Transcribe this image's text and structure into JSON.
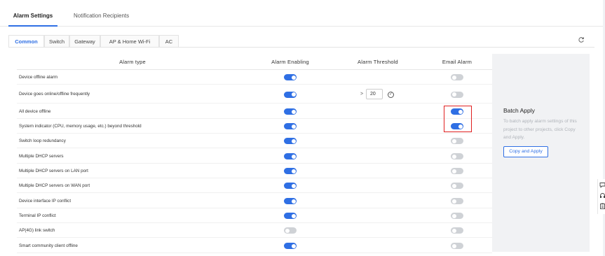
{
  "top_tabs": [
    {
      "label": "Alarm Settings",
      "active": true
    },
    {
      "label": "Notification Recipients",
      "active": false
    }
  ],
  "sub_tabs": [
    {
      "label": "Common",
      "active": true
    },
    {
      "label": "Switch",
      "active": false
    },
    {
      "label": "Gateway",
      "active": false
    },
    {
      "label": "AP & Home Wi-Fi",
      "active": false
    },
    {
      "label": "AC",
      "active": false
    }
  ],
  "table": {
    "headers": [
      "Alarm type",
      "Alarm Enabling",
      "Alarm Threshold",
      "Email Alarm"
    ],
    "rows": [
      {
        "type": "Device offline alarm",
        "enabled": true,
        "email": false
      },
      {
        "type": "Device goes online/offline frequently",
        "enabled": true,
        "email": false,
        "threshold_op": ">",
        "threshold": "20"
      },
      {
        "type": "All device offline",
        "enabled": true,
        "email": true
      },
      {
        "type": "System indicator (CPU, memory usage, etc.) beyond threshold",
        "enabled": true,
        "email": true
      },
      {
        "type": "Switch loop redundancy",
        "enabled": true,
        "email": false
      },
      {
        "type": "Multiple DHCP servers",
        "enabled": true,
        "email": false
      },
      {
        "type": "Multiple DHCP servers on LAN port",
        "enabled": true,
        "email": false
      },
      {
        "type": "Multiple DHCP servers on WAN port",
        "enabled": true,
        "email": false
      },
      {
        "type": "Device interface IP conflict",
        "enabled": true,
        "email": false
      },
      {
        "type": "Terminal IP conflict",
        "enabled": true,
        "email": false
      },
      {
        "type": "AP(4G) link switch",
        "enabled": false,
        "email": false
      },
      {
        "type": "Smart community client offline",
        "enabled": true,
        "email": false
      }
    ]
  },
  "batch": {
    "title": "Batch Apply",
    "description": "To batch apply alarm settings of this project to other projects, click Copy and Apply.",
    "button": "Copy and Apply"
  },
  "icons": {
    "refresh": "refresh-icon",
    "side": [
      "chat-icon",
      "headset-icon",
      "clipboard-icon"
    ]
  },
  "colors": {
    "accent": "#2f6fe4",
    "toggle_off": "#cfd2d6",
    "highlight": "#e02020"
  }
}
